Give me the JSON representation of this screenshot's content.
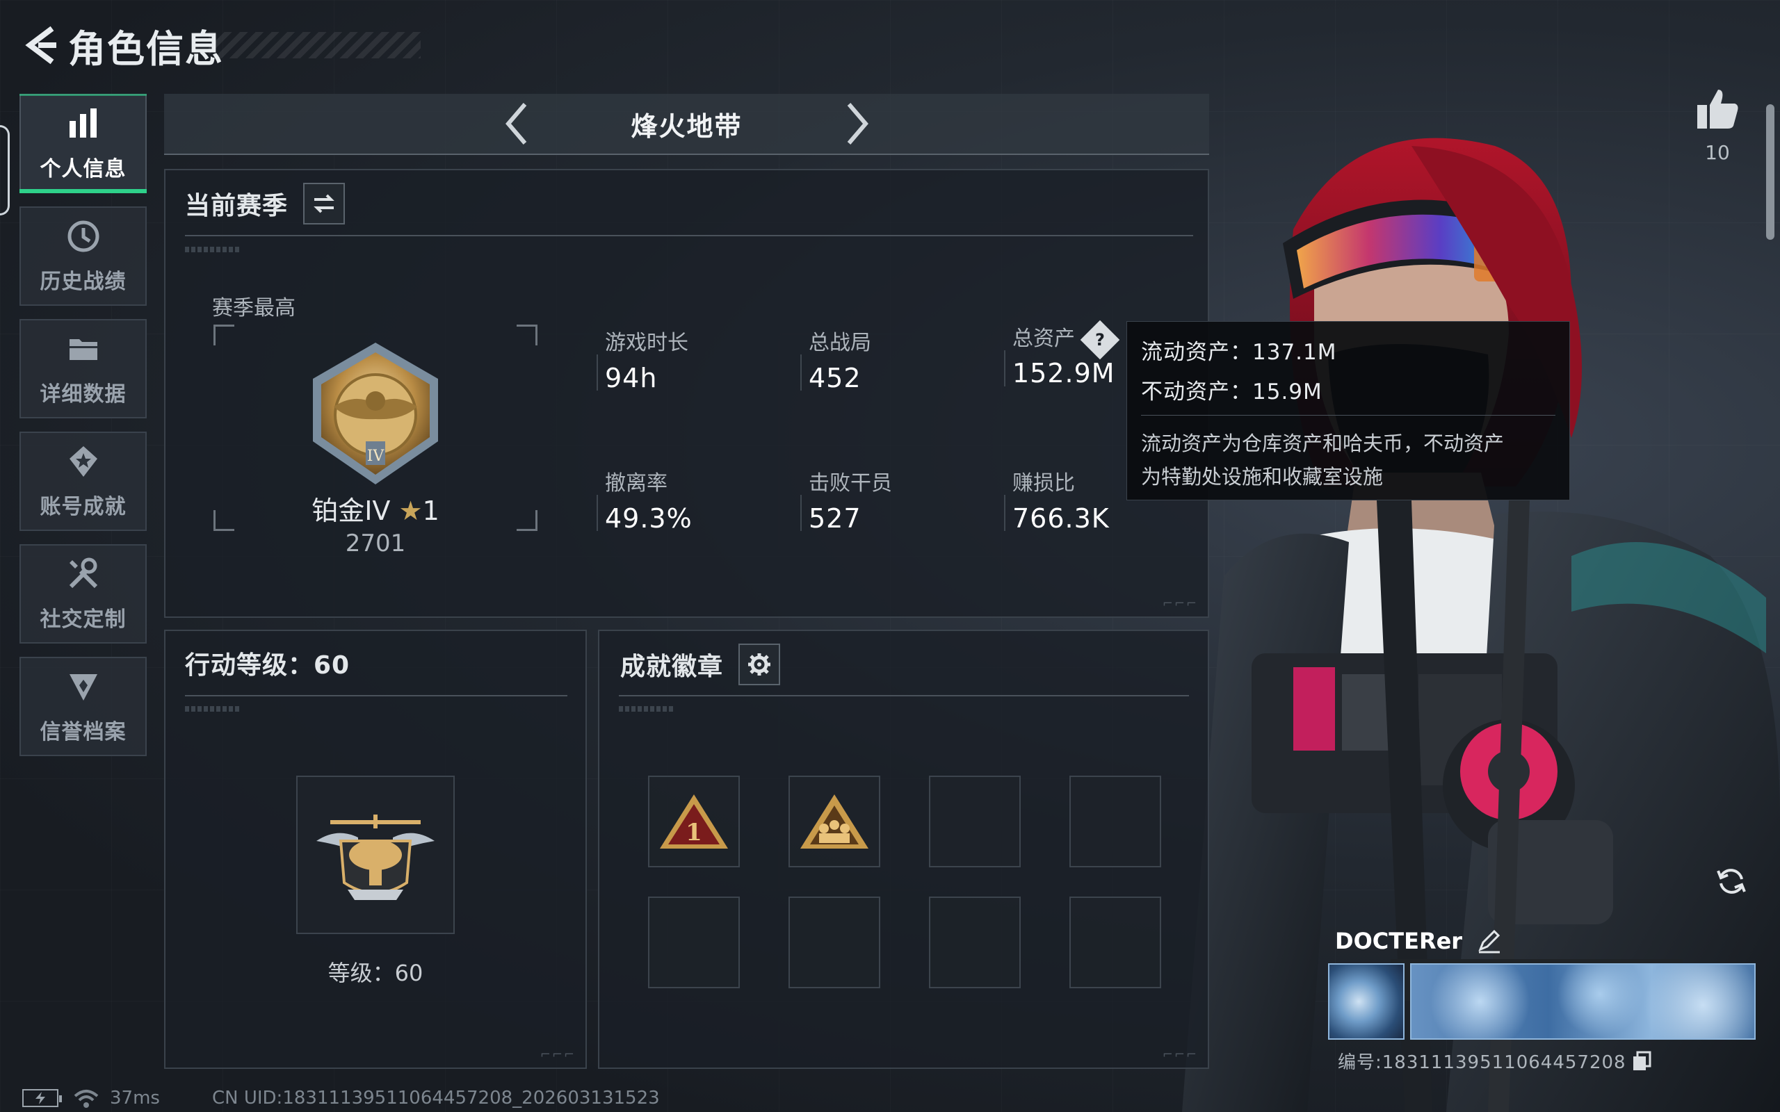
{
  "header": {
    "title": "角色信息"
  },
  "sidebar": {
    "items": [
      {
        "label": "个人信息",
        "icon": "bar-chart-icon",
        "active": true
      },
      {
        "label": "历史战绩",
        "icon": "history-clock-icon"
      },
      {
        "label": "详细数据",
        "icon": "folder-icon"
      },
      {
        "label": "账号成就",
        "icon": "achievement-icon"
      },
      {
        "label": "社交定制",
        "icon": "tools-icon"
      },
      {
        "label": "信誉档案",
        "icon": "reputation-icon"
      }
    ]
  },
  "mode": {
    "title": "烽火地带"
  },
  "season": {
    "title": "当前赛季",
    "best_label": "赛季最高",
    "rank_name": "铂金IV",
    "rank_stars": "1",
    "rank_score": "2701",
    "stats": [
      {
        "label": "游戏时长",
        "value": "94h"
      },
      {
        "label": "总战局",
        "value": "452"
      },
      {
        "label": "总资产",
        "value": "152.9M"
      },
      {
        "label": "撤离率",
        "value": "49.3%"
      },
      {
        "label": "击败干员",
        "value": "527"
      },
      {
        "label": "赚损比",
        "value": "766.3K"
      }
    ]
  },
  "tooltip": {
    "liquid": "流动资产：137.1M",
    "fixed": "不动资产：15.9M",
    "desc_line1": "流动资产为仓库资产和哈夫币，不动资产",
    "desc_line2": "为特勤处设施和收藏室设施"
  },
  "action_level": {
    "title": "行动等级：60",
    "level_text": "等级：60"
  },
  "achievements": {
    "title": "成就徽章",
    "badge1_text": "1"
  },
  "like": {
    "count": "10"
  },
  "player": {
    "name": "DOCTERer",
    "id": "编号:18311139511064457208"
  },
  "status": {
    "ping": "37ms",
    "uid": "CN UID:18311139511064457208_202603131523"
  },
  "colors": {
    "accent": "#2ed18a",
    "gold": "#c9a55a"
  }
}
